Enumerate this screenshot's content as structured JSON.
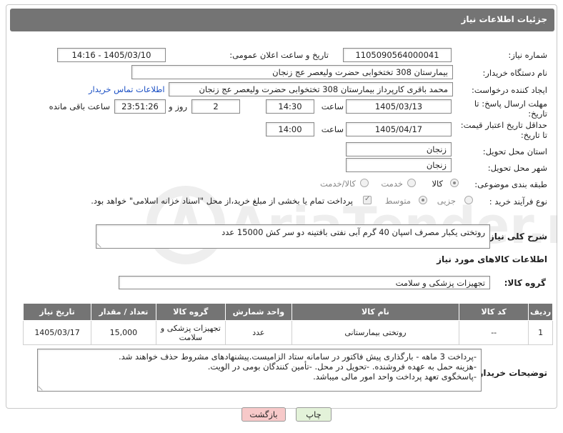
{
  "header": {
    "title": "جزئیات اطلاعات نیاز"
  },
  "fields": {
    "need_number_label": "شماره نیاز:",
    "need_number": "1105090564000041",
    "announce_label": "تاریخ و ساعت اعلان عمومی:",
    "announce_value": "1405/03/10 - 14:16",
    "buyer_org_label": "نام دستگاه خریدار:",
    "buyer_org": "بیمارستان 308 تختخوابی حضرت ولیعصر عج  زنجان",
    "requester_label": "ایجاد کننده درخواست:",
    "requester": "محمد باقری کارپرداز بیمارستان 308 تختخوابی حضرت ولیعصر عج  زنجان",
    "contact_link": "اطلاعات تماس خریدار",
    "deadline_label": "مهلت ارسال پاسخ: تا تاریخ:",
    "deadline_date": "1405/03/13",
    "time_label": "ساعت",
    "deadline_time": "14:30",
    "days_value": "2",
    "days_label": "روز و",
    "remaining_time": "23:51:26",
    "remaining_label": "ساعت باقی مانده",
    "validity_label": "حداقل تاریخ اعتبار قیمت: تا تاریخ:",
    "validity_date": "1405/04/17",
    "validity_time": "14:00",
    "province_label": "استان محل تحویل:",
    "province": "زنجان",
    "city_label": "شهر محل تحویل:",
    "city": "زنجان",
    "category_label": "طبقه بندی موضوعی:",
    "category_options": [
      "کالا",
      "خدمت",
      "کالا/خدمت"
    ],
    "process_label": "نوع فرآیند خرید :",
    "process_options": [
      "جزیی",
      "متوسط"
    ],
    "payment_note": "پرداخت تمام یا بخشی از مبلغ خرید،از محل \"اسناد خزانه اسلامی\" خواهد بود.",
    "description_label": "شرح کلی نیاز:",
    "description": "روتختی یکبار مصرف اسپان 40 گرم آبی نفتی بافتینه دو سر کش 15000 عدد"
  },
  "goods": {
    "section_title": "اطلاعات کالاهای مورد نیاز",
    "group_label": "گروه کالا:",
    "group_value": "تجهیزات پزشکی و سلامت",
    "columns": [
      "ردیف",
      "کد کالا",
      "نام کالا",
      "واحد شمارش",
      "گروه کالا",
      "تعداد / مقدار",
      "تاریخ نیاز"
    ],
    "rows": [
      {
        "row": "1",
        "code": "--",
        "name": "روتختی بیمارستانی",
        "unit": "عدد",
        "group": "تجهیزات پزشکی و سلامت",
        "qty": "15,000",
        "date": "1405/03/17"
      }
    ]
  },
  "buyer_notes": {
    "label": "توضیحات خریدار:",
    "lines": [
      "-پرداخت  3 ماهه - بارگذاری پیش فاکتور در سامانه ستاد الزامیست.پیشنهادهای مشروط حذف خواهند شد.",
      "-هزینه حمل به عهده فروشنده. -تحویل در محل. -تأمین کنندگان بومی در الویت.",
      "-پاسخگوی تعهد پرداخت واحد امور مالی میباشد."
    ]
  },
  "buttons": {
    "print": "چاپ",
    "back": "بازگشت"
  },
  "watermark": {
    "brand": "AriaTender.net"
  },
  "colors": {
    "header_bg": "#747474",
    "link": "#1a4fc4",
    "back_btn": "#f7c9c9",
    "print_btn": "#e3f2d9"
  }
}
